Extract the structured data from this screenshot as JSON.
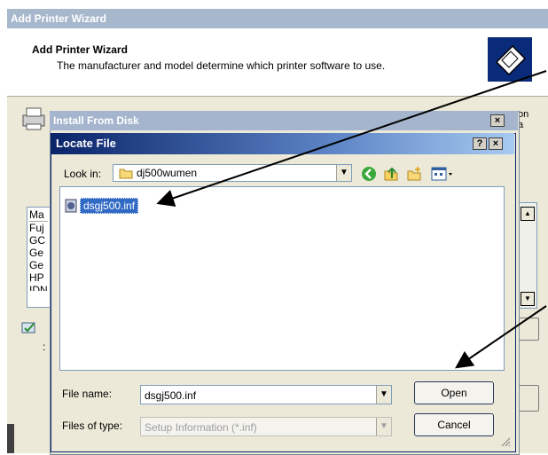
{
  "wizard": {
    "title": "Add Printer Wizard",
    "heading": "Add Printer Wizard",
    "subheading": "The manufacturer and model determine which printer software to use.",
    "side_text_1": "on",
    "side_text_2": "a",
    "list_items": [
      "Ma",
      "Fuj",
      "GC",
      "Ge",
      "Ge",
      "HP",
      "IDN"
    ]
  },
  "install_from_disk": {
    "title": "Install From Disk",
    "close_label": "×"
  },
  "locate_file": {
    "title": "Locate File",
    "help_label": "?",
    "close_label": "×",
    "look_in_label": "Look in:",
    "look_in_value": "dj500wumen",
    "file": "dsgj500.inf",
    "file_name_label": "File name:",
    "file_name_value": "dsgj500.inf",
    "files_of_type_label": "Files of type:",
    "files_of_type_value": "Setup Information (*.inf)",
    "open_label": "Open",
    "cancel_label": "Cancel"
  },
  "colors": {
    "title_active": "#0a246a",
    "selection": "#316ac5",
    "dialog_bg": "#ece9d8"
  },
  "icons": [
    "folder-icon",
    "back-icon",
    "up-folder-icon",
    "new-folder-icon",
    "views-icon",
    "inf-file-icon",
    "printer-icon"
  ]
}
